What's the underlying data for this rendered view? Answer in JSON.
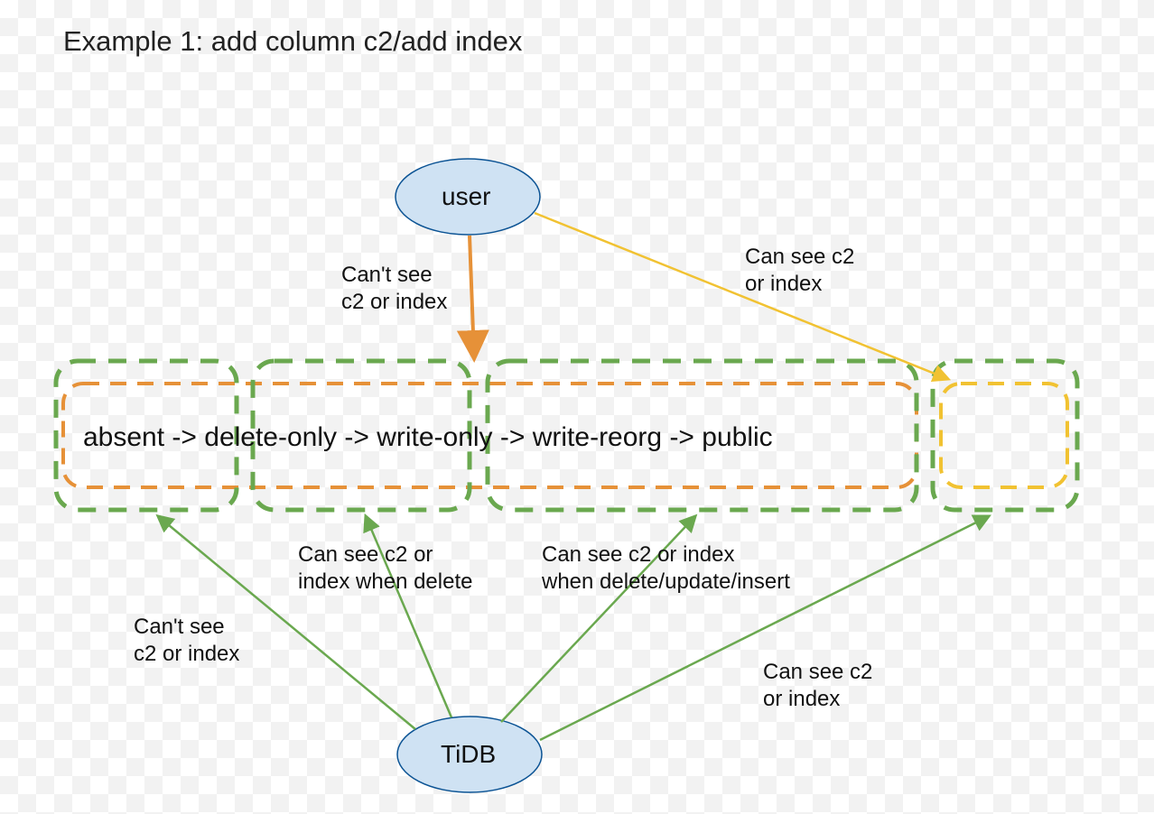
{
  "title": "Example 1: add column c2/add index",
  "nodes": {
    "user": "user",
    "tidb": "TiDB"
  },
  "state_sequence": "absent -> delete-only -> write-only -> write-reorg -> public",
  "states": [
    "absent",
    "delete-only",
    "write-only",
    "write-reorg",
    "public"
  ],
  "annotations": {
    "user_cant_see": "Can't see\nc2 or index",
    "user_can_see": "Can see c2\nor index",
    "tidb_absent": "Can't see\nc2 or index",
    "tidb_delete_only": "Can see c2 or\nindex when delete",
    "tidb_write_only": "Can see c2 or index\nwhen delete/update/insert",
    "tidb_public": "Can see c2\nor index"
  },
  "colors": {
    "ellipse_fill": "#cfe2f3",
    "ellipse_stroke": "#0b5394",
    "green": "#6aa84f",
    "orange": "#e69138",
    "yellow": "#f1c232"
  }
}
